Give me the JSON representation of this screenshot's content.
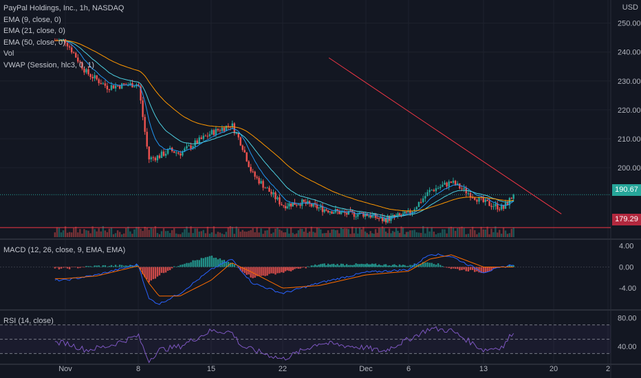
{
  "legend": {
    "symbol": "PayPal Holdings, Inc., 1h, NASDAQ",
    "studies": [
      "EMA (9, close, 0)",
      "EMA (21, close, 0)",
      "EMA (50, close, 0)",
      "Vol",
      "VWAP (Session, hlc3, 0, 1)"
    ]
  },
  "currency": "USD",
  "panes": {
    "macd_title": "MACD (12, 26, close, 9, EMA, EMA)",
    "rsi_title": "RSI (14, close)"
  },
  "price_axis": {
    "ticks": [
      "250.00",
      "240.00",
      "230.00",
      "220.00",
      "210.00",
      "200.00"
    ]
  },
  "macd_axis": {
    "ticks": [
      "4.00",
      "0.00",
      "-4.00"
    ]
  },
  "rsi_axis": {
    "ticks": [
      "80.00",
      "40.00"
    ]
  },
  "labels": {
    "last_price": "190.67",
    "horizontal_line": "179.29",
    "last_price_color": "#26a69a",
    "line_color": "#b2283e"
  },
  "colors": {
    "background": "#131722",
    "up": "#26a69a",
    "down": "#ef5350",
    "ema9": "#2196f3",
    "ema21": "#4dd0e1",
    "ema50": "#ff9800",
    "trendline": "#f23645",
    "macd": "#2962ff",
    "signal": "#ff6d00",
    "rsi": "#7e57c2"
  },
  "chart_data": [
    {
      "type": "candlestick",
      "title": "PayPal Holdings, Inc., 1h, NASDAQ",
      "x_tick_labels": [
        "Nov",
        "8",
        "15",
        "22",
        "Dec",
        "6",
        "13",
        "20",
        "2"
      ],
      "ylim": [
        176,
        258
      ],
      "series": [
        {
          "name": "Price (close, keypoints)",
          "x": [
            "Nov 1",
            "Nov 3",
            "Nov 5",
            "Nov 8",
            "Nov 9",
            "Nov 10",
            "Nov 11",
            "Nov 12",
            "Nov 15",
            "Nov 17",
            "Nov 18",
            "Nov 19",
            "Nov 22",
            "Nov 24",
            "Nov 26",
            "Nov 29",
            "Dec 1",
            "Dec 3",
            "Dec 6",
            "Dec 8",
            "Dec 10",
            "Dec 13",
            "Dec 15",
            "Dec 16"
          ],
          "values": [
            244,
            233,
            228,
            229,
            203,
            204,
            206,
            205,
            212,
            215,
            208,
            198,
            187,
            188,
            186,
            184,
            184,
            182,
            184,
            192,
            195,
            188,
            186,
            190.67
          ]
        },
        {
          "name": "EMA (9, close, 0)"
        },
        {
          "name": "EMA (21, close, 0)"
        },
        {
          "name": "EMA (50, close, 0)"
        },
        {
          "name": "VWAP (Session, hlc3, 0, 1)"
        },
        {
          "name": "Vol"
        }
      ],
      "horizontal_line": 179.29,
      "last_price": 190.67,
      "trendline": {
        "from": [
          "Oct 28",
          238
        ],
        "to": [
          "Dec 21",
          184
        ]
      }
    },
    {
      "type": "macd",
      "title": "MACD (12, 26, close, 9, EMA, EMA)",
      "ylim": [
        -8,
        5
      ],
      "series": [
        {
          "name": "Histogram"
        },
        {
          "name": "MACD"
        },
        {
          "name": "Signal"
        }
      ],
      "x": [
        "Nov 1",
        "Nov 4",
        "Nov 8",
        "Nov 9",
        "Nov 10",
        "Nov 12",
        "Nov 15",
        "Nov 17",
        "Nov 19",
        "Nov 22",
        "Nov 26",
        "Dec 1",
        "Dec 6",
        "Dec 8",
        "Dec 10",
        "Dec 13",
        "Dec 16"
      ],
      "macd": [
        -2.5,
        -1.5,
        0.5,
        -6.0,
        -7.0,
        -5.0,
        -0.5,
        1.5,
        -3.0,
        -5.0,
        -3.0,
        -1.0,
        -0.5,
        2.5,
        2.0,
        -1.0,
        0.5
      ],
      "signal": [
        -2.2,
        -1.7,
        0.2,
        -3.0,
        -5.5,
        -5.5,
        -2.5,
        0.8,
        -1.0,
        -4.0,
        -3.5,
        -1.5,
        -0.8,
        1.5,
        2.3,
        0.0,
        0.0
      ]
    },
    {
      "type": "line",
      "title": "RSI (14, close)",
      "ylim": [
        15,
        90
      ],
      "bands": [
        30,
        50,
        70
      ],
      "series": [
        {
          "name": "RSI",
          "x": [
            "Nov 1",
            "Nov 3",
            "Nov 5",
            "Nov 8",
            "Nov 9",
            "Nov 10",
            "Nov 12",
            "Nov 15",
            "Nov 17",
            "Nov 18",
            "Nov 22",
            "Nov 26",
            "Dec 1",
            "Dec 3",
            "Dec 6",
            "Dec 8",
            "Dec 10",
            "Dec 13",
            "Dec 15",
            "Dec 16"
          ],
          "values": [
            45,
            35,
            40,
            55,
            20,
            35,
            40,
            62,
            60,
            40,
            22,
            45,
            38,
            33,
            50,
            65,
            62,
            35,
            40,
            62
          ]
        }
      ]
    }
  ]
}
